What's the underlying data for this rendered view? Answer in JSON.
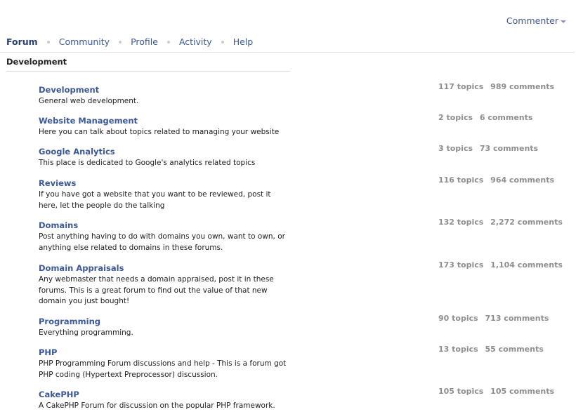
{
  "user_menu": {
    "label": "Commenter"
  },
  "nav": {
    "items": [
      {
        "label": "Forum",
        "active": true
      },
      {
        "label": "Community",
        "active": false
      },
      {
        "label": "Profile",
        "active": false
      },
      {
        "label": "Activity",
        "active": false
      },
      {
        "label": "Help",
        "active": false
      }
    ]
  },
  "section": {
    "title": "Development"
  },
  "forums": [
    {
      "name": "Development",
      "description": "General web development.",
      "topics": "117 topics",
      "comments": "989 comments"
    },
    {
      "name": "Website Management",
      "description": "Here you can talk about topics related to managing your website",
      "topics": "2 topics",
      "comments": "6 comments"
    },
    {
      "name": "Google Analytics",
      "description": "This place is dedicated to Google's analytics related topics",
      "topics": "3 topics",
      "comments": "73 comments"
    },
    {
      "name": "Reviews",
      "description": "If you have got a website that you want to be reviewed, post it here, let the people do the talking",
      "topics": "116 topics",
      "comments": "964 comments"
    },
    {
      "name": "Domains",
      "description": "Post anything having to do with domains you own, want to own, or anything else related to domains in these forums.",
      "topics": "132 topics",
      "comments": "2,272 comments"
    },
    {
      "name": "Domain Appraisals",
      "description": "Any webmaster that needs a domain appraised, post it in these forums. This is a great forum to find out the value of that new domain you just bought!",
      "topics": "173 topics",
      "comments": "1,104 comments"
    },
    {
      "name": "Programming",
      "description": "Everything programming.",
      "topics": "90 topics",
      "comments": "713 comments"
    },
    {
      "name": "PHP",
      "description": "PHP Programming Forum discussions and help - This is a forum got PHP coding (Hypertext Preprocessor) discussion.",
      "topics": "13 topics",
      "comments": "55 comments"
    },
    {
      "name": "CakePHP",
      "description": "A CakePHP Forum for discussion on the popular PHP framework.",
      "topics": "105 topics",
      "comments": "105 comments"
    }
  ],
  "colors": {
    "link": "#3b5998",
    "stats": "#8e8e8e"
  }
}
